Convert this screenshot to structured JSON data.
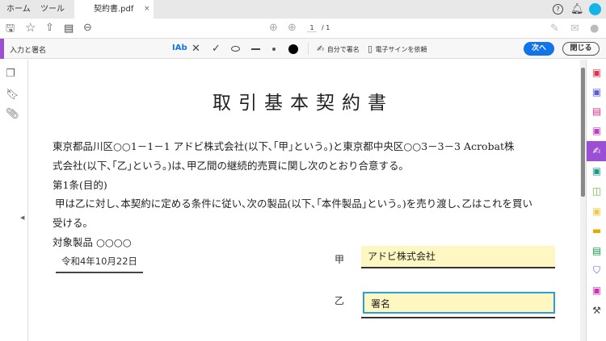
{
  "tabs": {
    "home": "ホーム",
    "tools": "ツール",
    "doc": "契約書.pdf",
    "close": "×"
  },
  "toolbar": {
    "page_current": "1",
    "page_total": "/ 1"
  },
  "fill_sign": {
    "title": "入力と署名",
    "text_tool": "IAb",
    "sign_self": "自分で署名",
    "request_esign": "電子サインを依頼",
    "next": "次へ",
    "close": "閉じる"
  },
  "document": {
    "title": "取引基本契約書",
    "lines": [
      "東京都品川区○○1－1－1 アドビ株式会社(以下､｢甲｣という｡)と東京都中央区○○3－3－3 Acrobat株",
      "式会社(以下､｢乙｣という｡)は､甲乙間の継続的売買に関し次のとおり合意する｡",
      "第1条(目的)",
      "甲は乙に対し､本契約に定める条件に従い､次の製品(以下､｢本件製品｣という｡)を売り渡し､乙はこれを買い",
      "受ける｡",
      "対象製品 ○○○○"
    ],
    "date": "令和4年10月22日",
    "party_a_label": "甲",
    "party_a_value": "アドビ株式会社",
    "party_b_label": "乙",
    "party_b_value": "署名"
  },
  "colors": {
    "accent": "#9b4fd4",
    "primary": "#1473e6",
    "field": "#fff7c2"
  }
}
